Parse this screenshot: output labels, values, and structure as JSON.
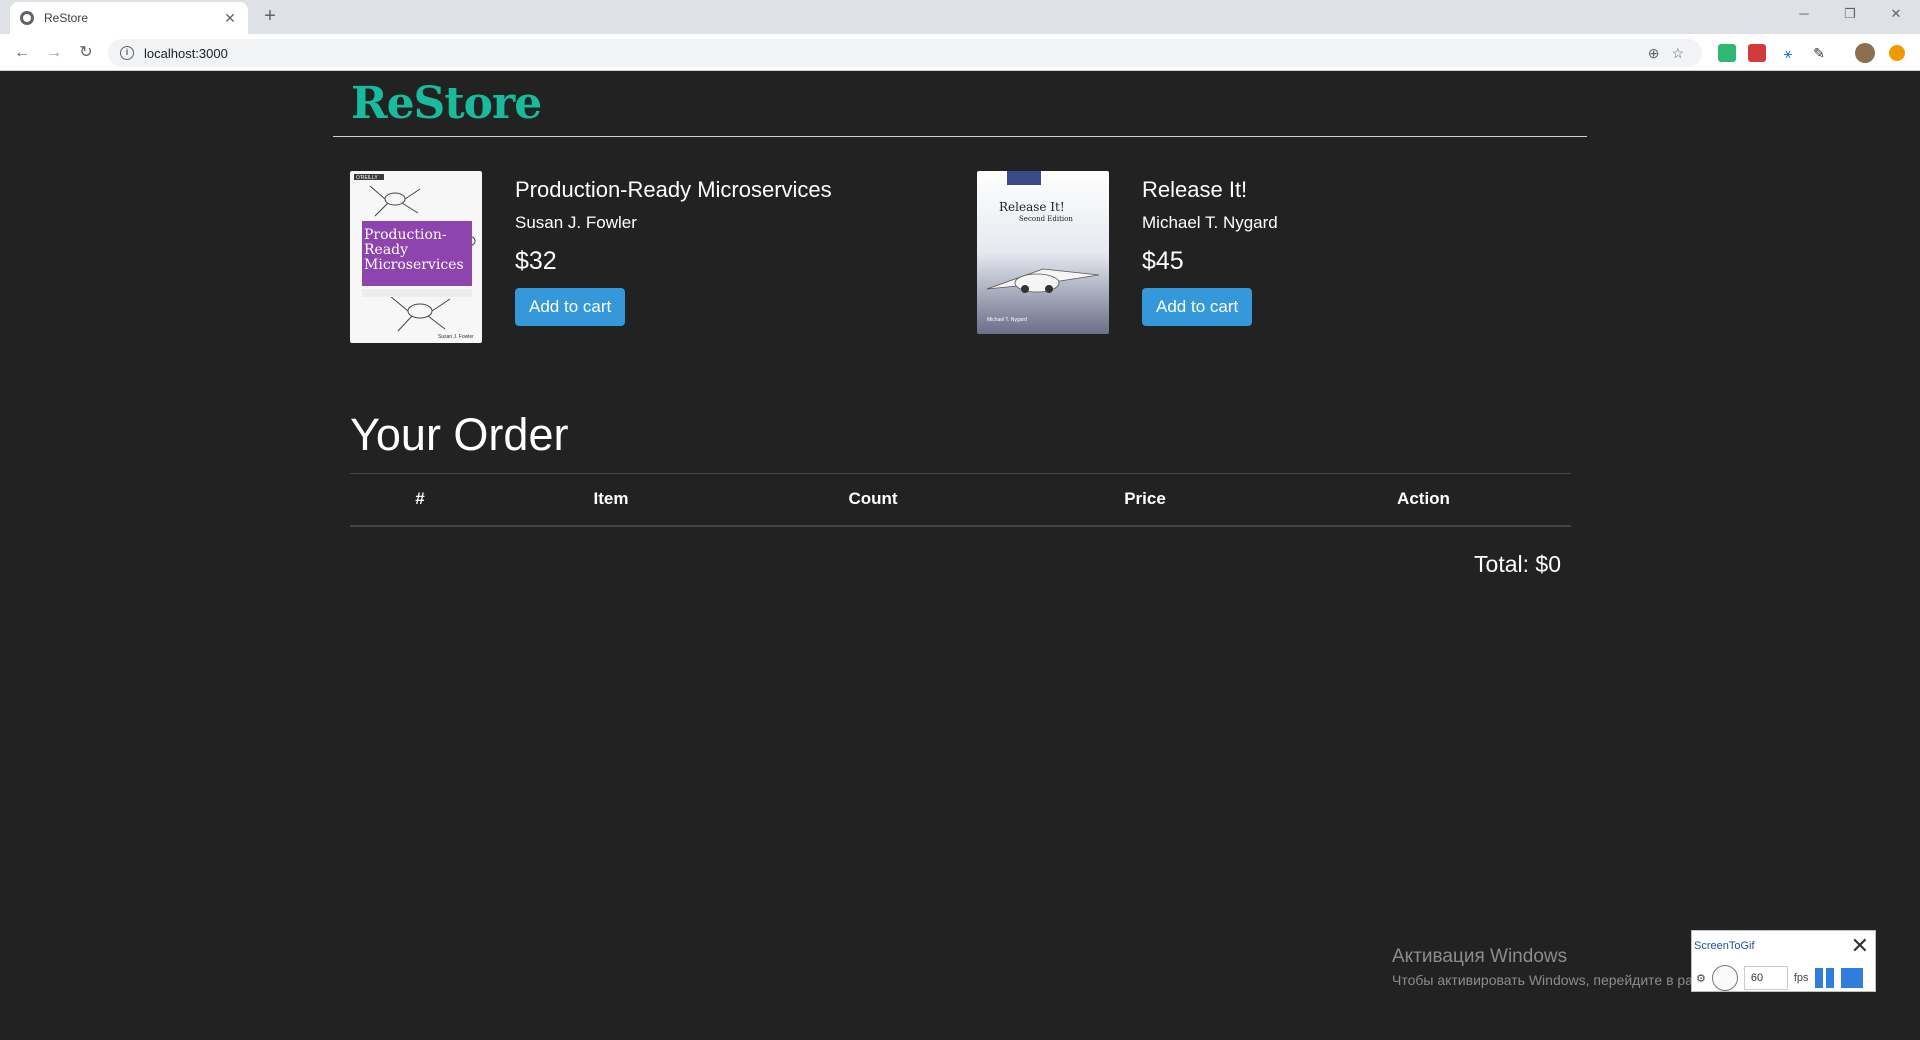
{
  "browser": {
    "tab_title": "ReStore",
    "tab_close": "✕",
    "new_tab": "+",
    "url": "localhost:3000",
    "window_controls": {
      "minimize": "─",
      "restore": "❐",
      "close": "✕"
    }
  },
  "app": {
    "logo": "ReStore"
  },
  "products": [
    {
      "title": "Production-Ready Microservices",
      "author": "Susan J. Fowler",
      "price": "$32",
      "button": "Add to cart",
      "cover_publisher": "O'REILLY",
      "cover_title_lines": [
        "Production-",
        "Ready",
        "Microservices"
      ],
      "cover_author": "Susan J. Fowler"
    },
    {
      "title": "Release It!",
      "author": "Michael T. Nygard",
      "price": "$45",
      "button": "Add to cart",
      "cover_title": "Release It!",
      "cover_edition": "Second Edition",
      "cover_author": "Michael T. Nygard"
    }
  ],
  "order": {
    "heading": "Your Order",
    "columns": [
      "#",
      "Item",
      "Count",
      "Price",
      "Action"
    ],
    "rows": [],
    "total": "Total: $0"
  },
  "watermark": {
    "line1": "Активация Windows",
    "line2": "Чтобы активировать Windows, перейдите в раздел \"Параметры\"."
  },
  "screentogif": {
    "title": "ScreenToGif",
    "fps_value": "60",
    "fps_label": "fps"
  }
}
